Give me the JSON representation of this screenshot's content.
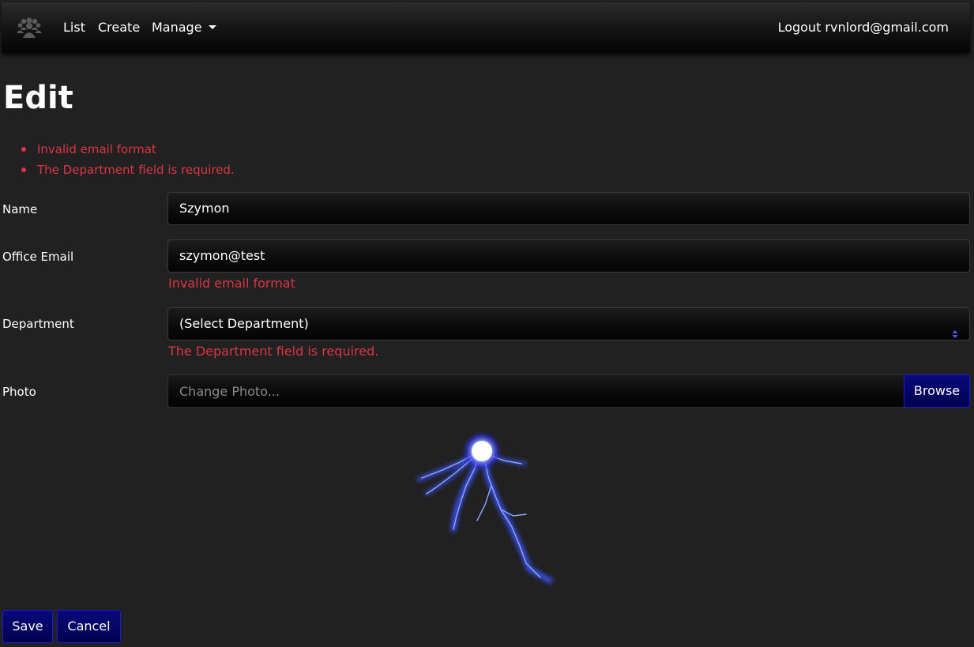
{
  "navbar": {
    "brand_icon": "users-group-icon",
    "links": {
      "list": "List",
      "create": "Create",
      "manage": "Manage"
    },
    "logout": "Logout rvnlord@gmail.com"
  },
  "page": {
    "title": "Edit"
  },
  "validation_summary": [
    "Invalid email format",
    "The Department field is required."
  ],
  "form": {
    "name": {
      "label": "Name",
      "value": "Szymon"
    },
    "email": {
      "label": "Office Email",
      "value": "szymon@test",
      "error": "Invalid email format"
    },
    "department": {
      "label": "Department",
      "selected": "(Select Department)",
      "error": "The Department field is required."
    },
    "photo": {
      "label": "Photo",
      "placeholder": "Change Photo...",
      "browse_label": "Browse"
    }
  },
  "actions": {
    "save": "Save",
    "cancel": "Cancel"
  },
  "colors": {
    "background": "#212121",
    "error": "#dc3545",
    "button": "#02025a",
    "button_border": "#1c1cd0"
  }
}
